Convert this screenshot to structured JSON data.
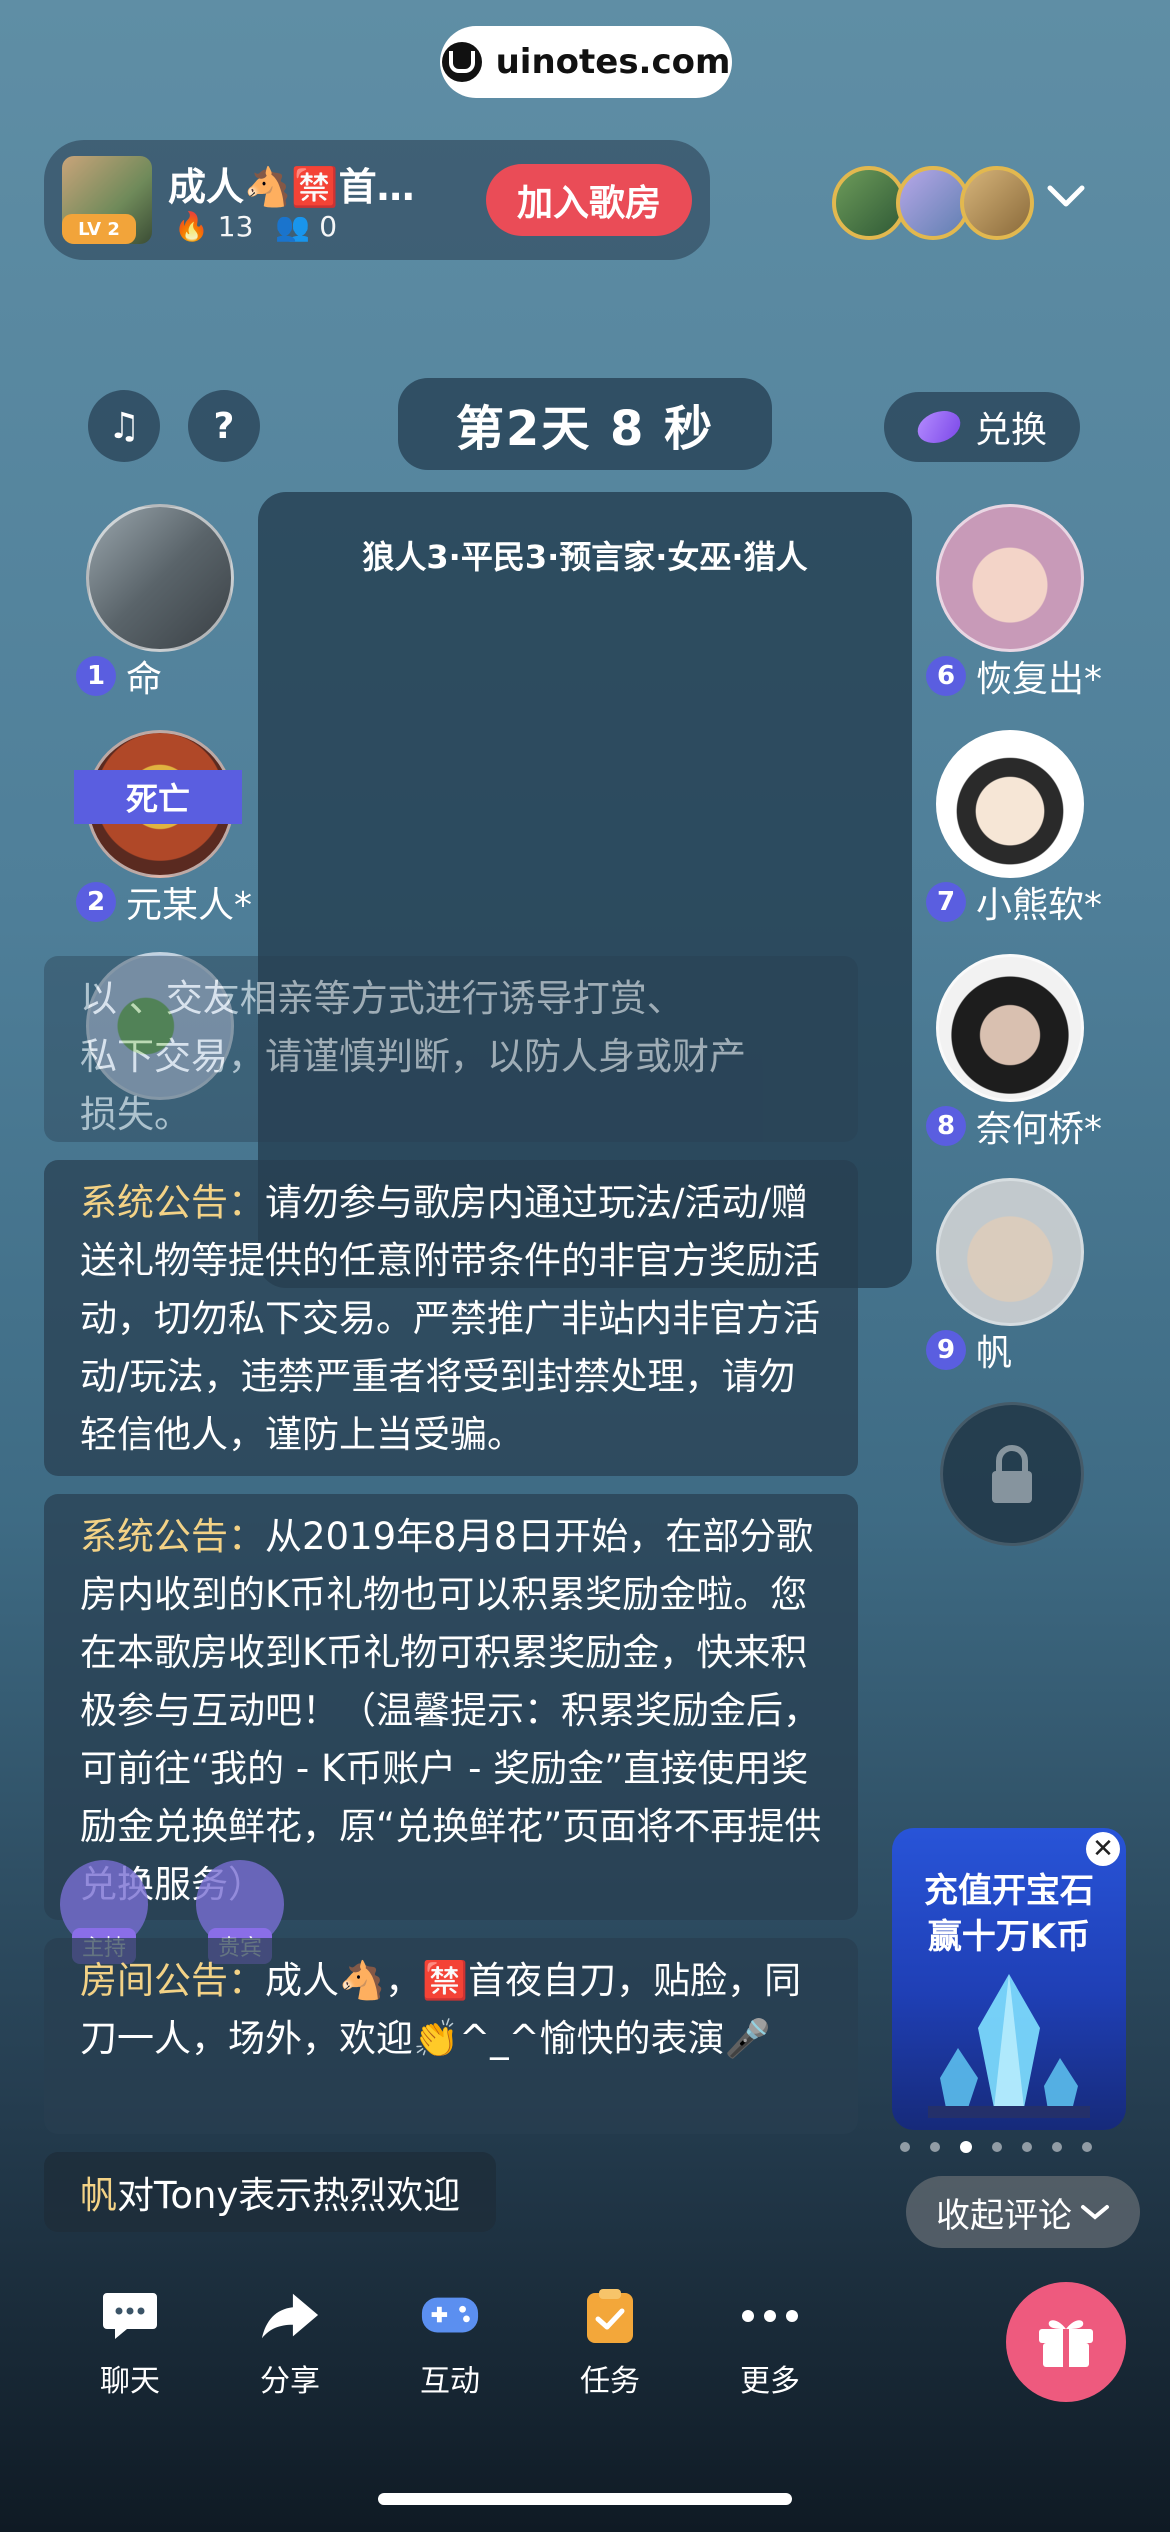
{
  "watermark": {
    "text": "uinotes.com"
  },
  "room": {
    "title": "成人🐴🈲首…",
    "level": "LV 2",
    "fire_count": "13",
    "listener_count": "0",
    "join_button": "加入歌房"
  },
  "controls": {
    "music_icon": "♫",
    "help_icon": "?",
    "timer": "第2天 8 秒",
    "exchange_label": "兑换"
  },
  "game": {
    "roles": "狼人3·平民3·预言家·女巫·猎人",
    "dead_tag": "死亡"
  },
  "seats": {
    "left": [
      {
        "num": "1",
        "name": "命"
      },
      {
        "num": "2",
        "name": "元某人*"
      }
    ],
    "right": [
      {
        "num": "6",
        "name": "恢复出*"
      },
      {
        "num": "7",
        "name": "小熊软*"
      },
      {
        "num": "8",
        "name": "奈何桥*"
      },
      {
        "num": "9",
        "name": "帆"
      }
    ]
  },
  "chat": {
    "faded_lines": [
      "以 、交友相亲等方式进行诱导打赏、",
      "私下交易，请谨慎判断，以防人身或财产",
      "损失。"
    ],
    "notice1_label": "系统公告：",
    "notice1_text": "请勿参与歌房内通过玩法/活动/赠送礼物等提供的任意附带条件的非官方奖励活动，切勿私下交易。严禁推广非站内非官方活动/玩法，违禁严重者将受到封禁处理，请勿轻信他人，谨防上当受骗。",
    "notice2_label": "系统公告：",
    "notice2_text": "从2019年8月8日开始，在部分歌房内收到的K币礼物也可以积累奖励金啦。您在本歌房收到K币礼物可积累奖励金，快来积极参与互动吧！（温馨提示：积累奖励金后，可前往“我的 - K币账户 - 奖励金”直接使用奖励金兑换鲜花，原“兑换鲜花”页面将不再提供兑换服务）",
    "room_notice_label": "房间公告：",
    "room_notice_text": "成人🐴，🈲首夜自刀，贴脸，同刀一人，场外，欢迎👏^_^愉快的表演🎤",
    "welcome_name": "帆",
    "welcome_text": "对Tony表示热烈欢迎"
  },
  "badges": {
    "host": "主持",
    "guest": "贵宾"
  },
  "ad": {
    "line1": "充值开宝石",
    "line2": "赢十万K币",
    "close": "✕"
  },
  "collapse_label": "收起评论",
  "toolbar": {
    "chat": "聊天",
    "share": "分享",
    "interact": "互动",
    "task": "任务",
    "more": "更多"
  },
  "colors": {
    "accent_red": "#ea4c57",
    "seat_blue": "#5a5ee0",
    "notice_gold": "#f3d286",
    "gift_pink": "#ee5a7e"
  }
}
